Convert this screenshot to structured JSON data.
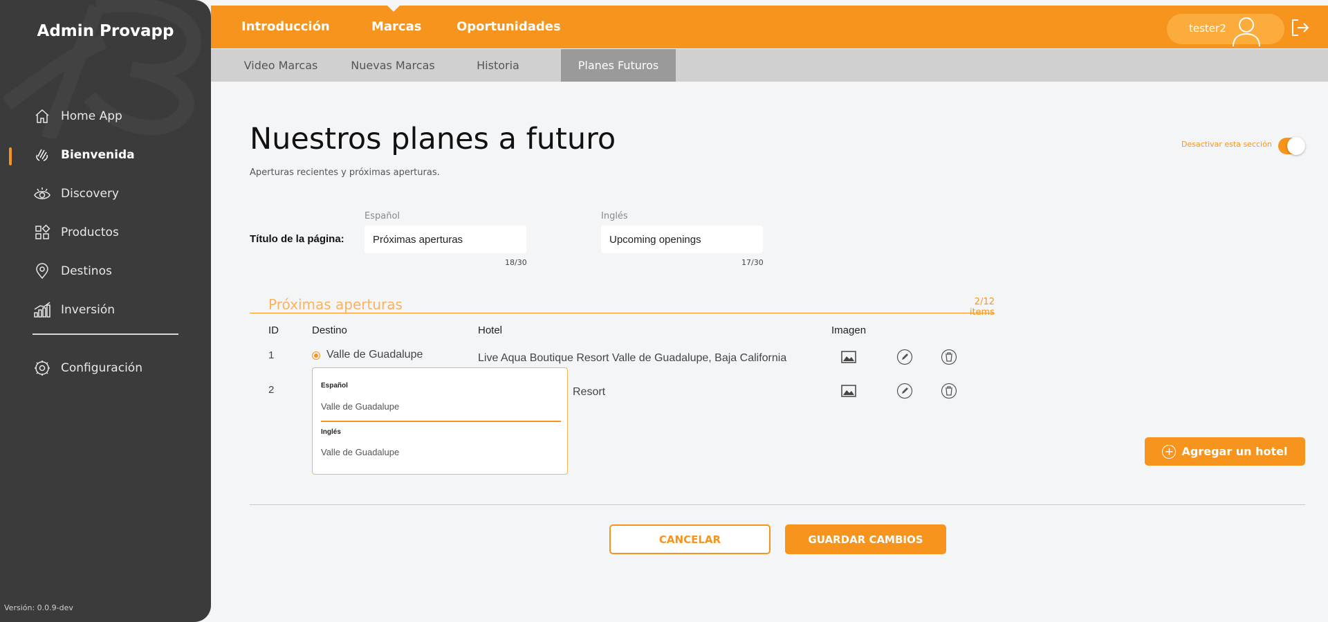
{
  "app": {
    "brand": "Admin Provapp",
    "version": "Versión: 0.0.9-dev"
  },
  "sidebar": {
    "items": [
      {
        "label": "Home App",
        "icon": "home-icon"
      },
      {
        "label": "Bienvenida",
        "icon": "waving-hand-icon",
        "active": true
      },
      {
        "label": "Discovery",
        "icon": "eye-icon"
      },
      {
        "label": "Productos",
        "icon": "grid-icon"
      },
      {
        "label": "Destinos",
        "icon": "location-pin-icon"
      },
      {
        "label": "Inversión",
        "icon": "bar-chart-icon"
      }
    ],
    "config": {
      "label": "Configuración",
      "icon": "gear-icon"
    }
  },
  "topnav": {
    "tabs": [
      {
        "label": "Introducción"
      },
      {
        "label": "Marcas",
        "active": true
      },
      {
        "label": "Oportunidades"
      }
    ],
    "user": "tester2"
  },
  "subnav": {
    "tabs": [
      {
        "label": "Video Marcas"
      },
      {
        "label": "Nuevas Marcas"
      },
      {
        "label": "Historia"
      },
      {
        "label": "Planes Futuros",
        "active": true
      }
    ]
  },
  "page": {
    "title": "Nuestros planes a futuro",
    "subtitle": "Aperturas recientes y próximas aperturas.",
    "toggle_label": "Desactivar esta sección",
    "toggle_on": true,
    "title_field_label": "Título de la página:",
    "spanish_label": "Español",
    "english_label": "Inglés",
    "spanish_value": "Próximas aperturas",
    "spanish_counter": "18/30",
    "english_value": "Upcoming openings",
    "english_counter": "17/30"
  },
  "section": {
    "title": "Próximas aperturas",
    "count": "2/12 items",
    "headers": {
      "id": "ID",
      "destino": "Destino",
      "hotel": "Hotel",
      "imagen": "Imagen"
    },
    "rows": [
      {
        "id": "1",
        "destino": "Valle de Guadalupe",
        "hotel": "Live Aqua Boutique Resort Valle de Guadalupe, Baja California"
      },
      {
        "id": "2",
        "destino": "",
        "hotel": "Resort"
      }
    ],
    "popover": {
      "spanish_label": "Español",
      "spanish_value": "Valle de Guadalupe",
      "english_label": "Inglés",
      "english_value": "Valle de Guadalupe"
    },
    "add_label": "Agregar un hotel"
  },
  "footer": {
    "cancel": "CANCELAR",
    "save": "GUARDAR CAMBIOS"
  },
  "colors": {
    "accent": "#f7941d",
    "sidebar": "#3b3b3b",
    "subbar": "#d0d0d0",
    "active_subtab": "#9a9a9a"
  }
}
